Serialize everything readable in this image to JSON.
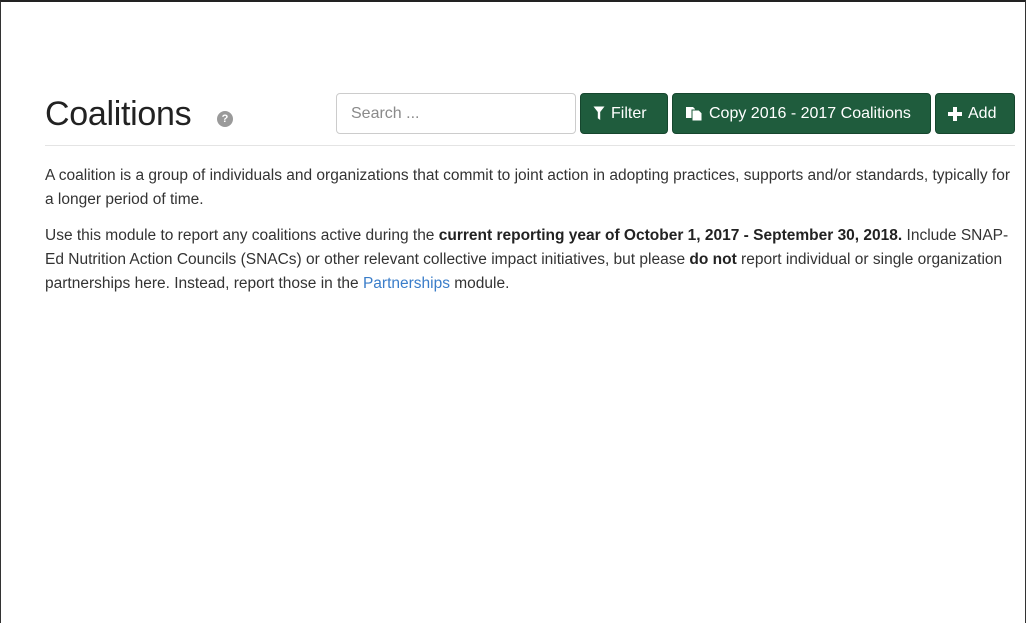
{
  "header": {
    "title": "Coalitions",
    "help_icon": "question-circle-icon",
    "help_glyph": "?"
  },
  "search": {
    "placeholder": "Search ...",
    "value": ""
  },
  "toolbar": {
    "filter_label": "Filter",
    "filter_icon": "filter-icon",
    "copy_label": "Copy 2016 - 2017 Coalitions",
    "copy_icon": "copy-icon",
    "add_label": "Add",
    "add_icon": "plus-icon",
    "button_color": "#1f5c3d"
  },
  "intro": {
    "paragraph1": "A coalition is a group of individuals and organizations that commit to joint action in adopting practices, supports and/or standards, typically for a longer period of time.",
    "paragraph2_part1": "Use this module to report any coalitions active during the ",
    "paragraph2_bold1": "current reporting year of October 1, 2017 - September 30, 2018.",
    "paragraph2_part2": " Include SNAP-Ed Nutrition Action Councils (SNACs) or other relevant collective impact initiatives, but please ",
    "paragraph2_bold2": "do not",
    "paragraph2_part3": " report individual or single organization partnerships here. Instead, report those in the ",
    "paragraph2_link": "Partnerships",
    "paragraph2_part4": " module.",
    "link_color": "#3a7dc9"
  }
}
